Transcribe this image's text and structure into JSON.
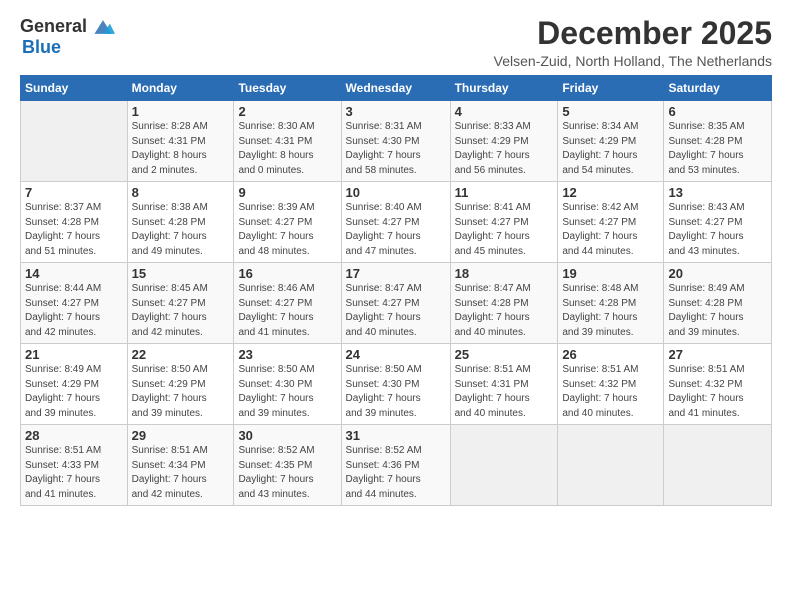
{
  "header": {
    "logo_general": "General",
    "logo_blue": "Blue",
    "month": "December 2025",
    "location": "Velsen-Zuid, North Holland, The Netherlands"
  },
  "weekdays": [
    "Sunday",
    "Monday",
    "Tuesday",
    "Wednesday",
    "Thursday",
    "Friday",
    "Saturday"
  ],
  "weeks": [
    [
      {
        "day": "",
        "info": ""
      },
      {
        "day": "1",
        "info": "Sunrise: 8:28 AM\nSunset: 4:31 PM\nDaylight: 8 hours\nand 2 minutes."
      },
      {
        "day": "2",
        "info": "Sunrise: 8:30 AM\nSunset: 4:31 PM\nDaylight: 8 hours\nand 0 minutes."
      },
      {
        "day": "3",
        "info": "Sunrise: 8:31 AM\nSunset: 4:30 PM\nDaylight: 7 hours\nand 58 minutes."
      },
      {
        "day": "4",
        "info": "Sunrise: 8:33 AM\nSunset: 4:29 PM\nDaylight: 7 hours\nand 56 minutes."
      },
      {
        "day": "5",
        "info": "Sunrise: 8:34 AM\nSunset: 4:29 PM\nDaylight: 7 hours\nand 54 minutes."
      },
      {
        "day": "6",
        "info": "Sunrise: 8:35 AM\nSunset: 4:28 PM\nDaylight: 7 hours\nand 53 minutes."
      }
    ],
    [
      {
        "day": "7",
        "info": "Sunrise: 8:37 AM\nSunset: 4:28 PM\nDaylight: 7 hours\nand 51 minutes."
      },
      {
        "day": "8",
        "info": "Sunrise: 8:38 AM\nSunset: 4:28 PM\nDaylight: 7 hours\nand 49 minutes."
      },
      {
        "day": "9",
        "info": "Sunrise: 8:39 AM\nSunset: 4:27 PM\nDaylight: 7 hours\nand 48 minutes."
      },
      {
        "day": "10",
        "info": "Sunrise: 8:40 AM\nSunset: 4:27 PM\nDaylight: 7 hours\nand 47 minutes."
      },
      {
        "day": "11",
        "info": "Sunrise: 8:41 AM\nSunset: 4:27 PM\nDaylight: 7 hours\nand 45 minutes."
      },
      {
        "day": "12",
        "info": "Sunrise: 8:42 AM\nSunset: 4:27 PM\nDaylight: 7 hours\nand 44 minutes."
      },
      {
        "day": "13",
        "info": "Sunrise: 8:43 AM\nSunset: 4:27 PM\nDaylight: 7 hours\nand 43 minutes."
      }
    ],
    [
      {
        "day": "14",
        "info": "Sunrise: 8:44 AM\nSunset: 4:27 PM\nDaylight: 7 hours\nand 42 minutes."
      },
      {
        "day": "15",
        "info": "Sunrise: 8:45 AM\nSunset: 4:27 PM\nDaylight: 7 hours\nand 42 minutes."
      },
      {
        "day": "16",
        "info": "Sunrise: 8:46 AM\nSunset: 4:27 PM\nDaylight: 7 hours\nand 41 minutes."
      },
      {
        "day": "17",
        "info": "Sunrise: 8:47 AM\nSunset: 4:27 PM\nDaylight: 7 hours\nand 40 minutes."
      },
      {
        "day": "18",
        "info": "Sunrise: 8:47 AM\nSunset: 4:28 PM\nDaylight: 7 hours\nand 40 minutes."
      },
      {
        "day": "19",
        "info": "Sunrise: 8:48 AM\nSunset: 4:28 PM\nDaylight: 7 hours\nand 39 minutes."
      },
      {
        "day": "20",
        "info": "Sunrise: 8:49 AM\nSunset: 4:28 PM\nDaylight: 7 hours\nand 39 minutes."
      }
    ],
    [
      {
        "day": "21",
        "info": "Sunrise: 8:49 AM\nSunset: 4:29 PM\nDaylight: 7 hours\nand 39 minutes."
      },
      {
        "day": "22",
        "info": "Sunrise: 8:50 AM\nSunset: 4:29 PM\nDaylight: 7 hours\nand 39 minutes."
      },
      {
        "day": "23",
        "info": "Sunrise: 8:50 AM\nSunset: 4:30 PM\nDaylight: 7 hours\nand 39 minutes."
      },
      {
        "day": "24",
        "info": "Sunrise: 8:50 AM\nSunset: 4:30 PM\nDaylight: 7 hours\nand 39 minutes."
      },
      {
        "day": "25",
        "info": "Sunrise: 8:51 AM\nSunset: 4:31 PM\nDaylight: 7 hours\nand 40 minutes."
      },
      {
        "day": "26",
        "info": "Sunrise: 8:51 AM\nSunset: 4:32 PM\nDaylight: 7 hours\nand 40 minutes."
      },
      {
        "day": "27",
        "info": "Sunrise: 8:51 AM\nSunset: 4:32 PM\nDaylight: 7 hours\nand 41 minutes."
      }
    ],
    [
      {
        "day": "28",
        "info": "Sunrise: 8:51 AM\nSunset: 4:33 PM\nDaylight: 7 hours\nand 41 minutes."
      },
      {
        "day": "29",
        "info": "Sunrise: 8:51 AM\nSunset: 4:34 PM\nDaylight: 7 hours\nand 42 minutes."
      },
      {
        "day": "30",
        "info": "Sunrise: 8:52 AM\nSunset: 4:35 PM\nDaylight: 7 hours\nand 43 minutes."
      },
      {
        "day": "31",
        "info": "Sunrise: 8:52 AM\nSunset: 4:36 PM\nDaylight: 7 hours\nand 44 minutes."
      },
      {
        "day": "",
        "info": ""
      },
      {
        "day": "",
        "info": ""
      },
      {
        "day": "",
        "info": ""
      }
    ]
  ]
}
